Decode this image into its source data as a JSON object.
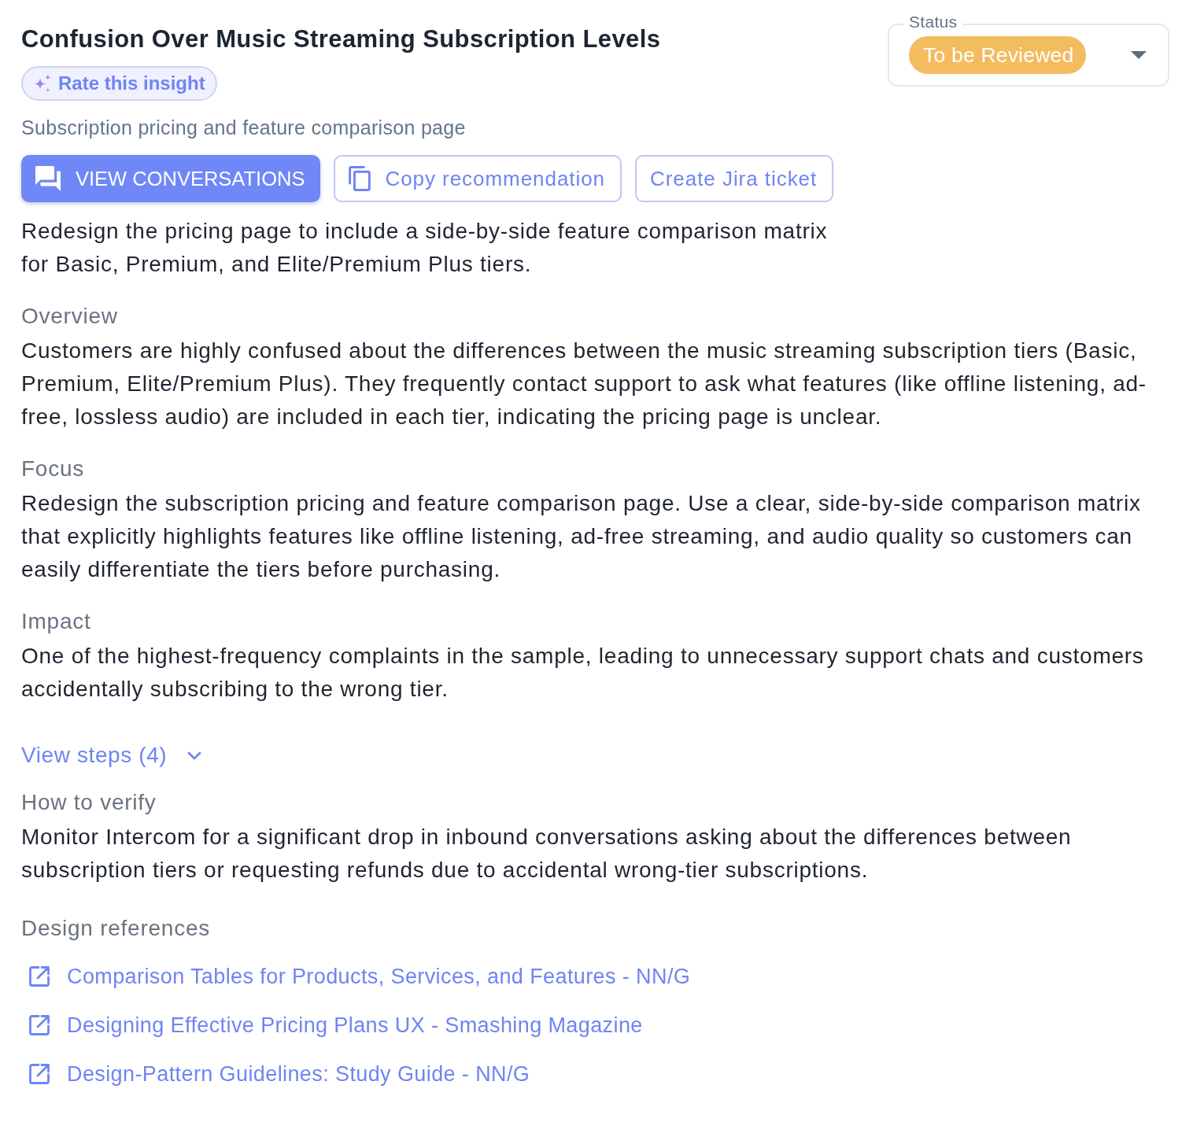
{
  "title": "Confusion Over Music Streaming Subscription Levels",
  "rate_button": {
    "label": "Rate this insight"
  },
  "subtitle": "Subscription pricing and feature comparison page",
  "status": {
    "label": "Status",
    "value": "To be Reviewed"
  },
  "buttons": {
    "view_conversations": {
      "label": "VIEW CONVERSATIONS"
    },
    "copy_recommendation": {
      "label": "Copy recommendation"
    },
    "create_jira_ticket": {
      "label": "Create Jira ticket"
    }
  },
  "recommendation": "Redesign the pricing page to include a side-by-side feature comparison matrix for Basic, Premium, and Elite/Premium Plus tiers.",
  "sections": [
    {
      "heading": "Overview",
      "text": "Customers are highly confused about the differences between the music streaming subscription tiers (Basic, Premium, Elite/Premium Plus). They frequently contact support to ask what features (like offline listening, ad-free, lossless audio) are included in each tier, indicating the pricing page is unclear."
    },
    {
      "heading": "Focus",
      "text": "Redesign the subscription pricing and feature comparison page. Use a clear, side-by-side comparison matrix that explicitly highlights features like offline listening, ad-free streaming, and audio quality so customers can easily differentiate the tiers before purchasing."
    },
    {
      "heading": "Impact",
      "text": "One of the highest-frequency complaints in the sample, leading to unnecessary support chats and customers accidentally subscribing to the wrong tier."
    }
  ],
  "steps_toggle": {
    "label": "View steps (4)",
    "expanded": false
  },
  "verification": {
    "heading": "How to verify",
    "text": "Monitor Intercom for a significant drop in inbound conversations asking about the differences between subscription tiers or requesting refunds due to accidental wrong-tier subscriptions."
  },
  "design_references": {
    "heading": "Design references",
    "links": [
      {
        "label": "Comparison Tables for Products, Services, and Features - NN/G"
      },
      {
        "label": "Designing Effective Pricing Plans UX - Smashing Magazine"
      },
      {
        "label": "Design-Pattern Guidelines: Study Guide - NN/G"
      }
    ]
  }
}
